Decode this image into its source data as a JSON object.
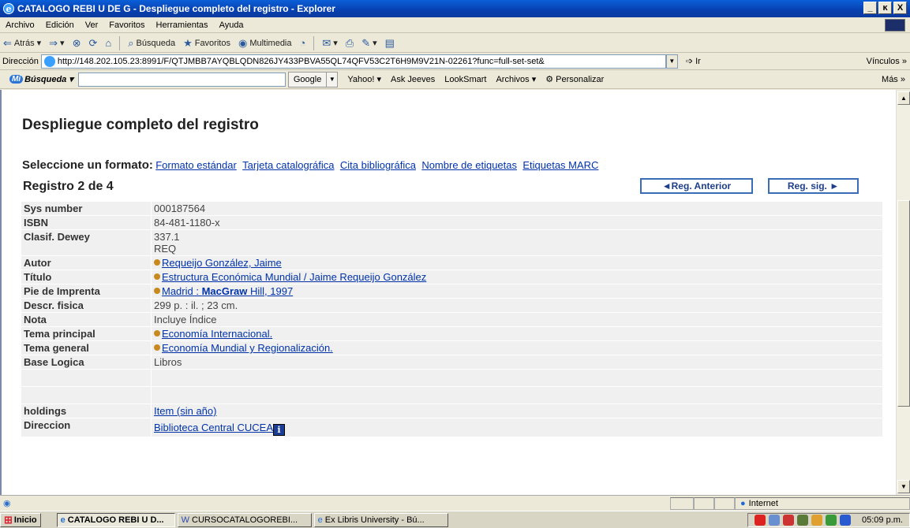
{
  "window": {
    "title": "CATALOGO REBI U DE G - Despliegue completo del registro - Explorer",
    "minimize": "_",
    "maximize": "ĸ",
    "close": "X"
  },
  "menu": [
    "Archivo",
    "Edición",
    "Ver",
    "Favoritos",
    "Herramientas",
    "Ayuda"
  ],
  "toolbar": {
    "back": "Atrás",
    "search": "Búsqueda",
    "favorites": "Favoritos",
    "multimedia": "Multimedia"
  },
  "address": {
    "label": "Dirección",
    "url": "http://148.202.105.23:8991/F/QTJMBB7AYQBLQDN826JY433PBVA55QL74QFV53C2T6H9M9V21N-02261?func=full-set-set&",
    "go": "Ir",
    "links": "Vínculos"
  },
  "searchbar": {
    "brand": "Búsqueda",
    "brand_badge": "Mi",
    "google": "Google",
    "items": [
      "Yahoo!",
      "Ask Jeeves",
      "LookSmart",
      "Archivos",
      "Personalizar"
    ],
    "more": "Más"
  },
  "page": {
    "title": "Despliegue completo del registro",
    "format_label": "Seleccione un formato:",
    "formats": [
      "Formato estándar",
      "Tarjeta catalográfica",
      "Cita bibliográfica",
      "Nombre de etiquetas",
      "Etiquetas MARC"
    ],
    "record_count": "Registro 2 de 4",
    "prev": "◄Reg. Anterior",
    "next": "Reg. sig. ►"
  },
  "record": {
    "sys_number_label": "Sys number",
    "sys_number": "000187564",
    "isbn_label": "ISBN",
    "isbn": "84-481-1180-x",
    "dewey_label": "Clasif. Dewey",
    "dewey_1": "337.1",
    "dewey_2": "REQ",
    "autor_label": "Autor",
    "autor": "Requeijo González, Jaime",
    "titulo_label": "Título",
    "titulo": "Estructura Económica Mundial / Jaime Requeijo González",
    "pie_label": "Pie de Imprenta",
    "pie_a": "Madrid : ",
    "pie_b": "MacGraw",
    "pie_c": " Hill, 1997",
    "descr_label": "Descr. fisica",
    "descr": "299 p. : il. ; 23 cm.",
    "nota_label": "Nota",
    "nota": "Incluye Índice",
    "tema_p_label": "Tema principal",
    "tema_p": "Economía Internacional.",
    "tema_g_label": "Tema general",
    "tema_g": "Economía Mundial y Regionalización.",
    "base_label": "Base Logica",
    "base": "Libros",
    "holdings_label": "holdings",
    "holdings": "Item (sin año)",
    "direccion_label": "Direccion",
    "direccion": "Biblioteca Central CUCEA",
    "info": "i"
  },
  "status": {
    "zone": "Internet"
  },
  "taskbar": {
    "start": "Inicio",
    "tasks": [
      "CATALOGO REBI U D...",
      "CURSOCATALOGOREBI...",
      "Ex Libris University - Bú..."
    ],
    "clock": "05:09 p.m."
  }
}
